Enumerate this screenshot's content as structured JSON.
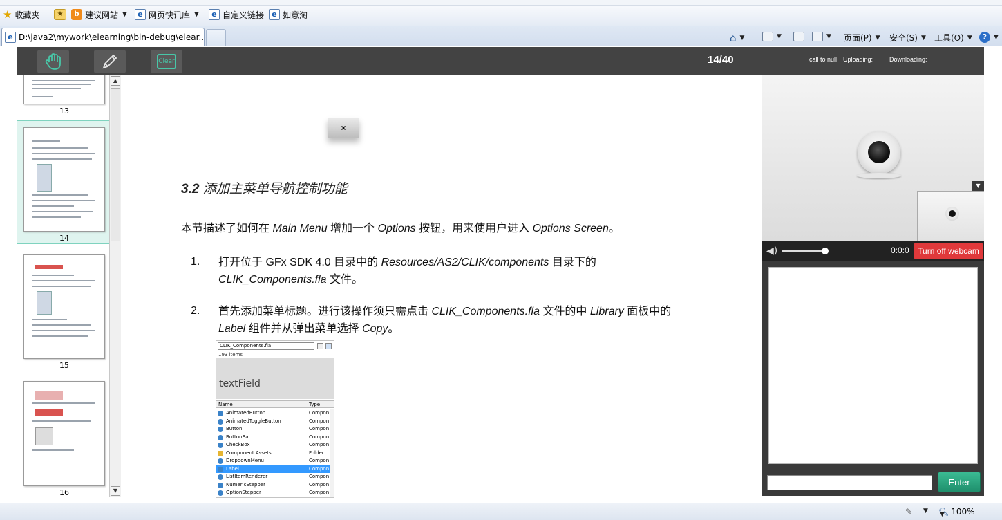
{
  "favorites_bar": {
    "favorites_label": "收藏夹",
    "items": [
      {
        "label": "建议网站",
        "icon": "suggested-sites-icon"
      },
      {
        "label": "网页快讯库",
        "icon": "web-slice-icon"
      },
      {
        "label": "自定义链接",
        "icon": "ie-page-icon"
      },
      {
        "label": "如意淘",
        "icon": "ie-page-icon"
      }
    ]
  },
  "tabs": {
    "active_title": "D:\\java2\\mywork\\elearning\\bin-debug\\elear..."
  },
  "command_bar": {
    "page_label": "页面(P)",
    "safety_label": "安全(S)",
    "tools_label": "工具(O)",
    "help_label": "?"
  },
  "toolbar": {
    "hand_tool": "hand-icon",
    "pen_tool": "pencil-icon",
    "clear_label": "Clear",
    "page_counter": "14/40",
    "status_call": "call to null",
    "status_upload": "Uploading:",
    "status_download": "Downloading:"
  },
  "thumbnails": [
    {
      "label": "13"
    },
    {
      "label": "14",
      "selected": true
    },
    {
      "label": "15"
    },
    {
      "label": "16"
    }
  ],
  "document": {
    "close_label": "×",
    "section_number": "3.2",
    "section_title": "添加主菜单导航控制功能",
    "intro": {
      "a": "本节描述了如何在 ",
      "b": "Main Menu",
      "c": " 增加一个 ",
      "d": "Options",
      "e": " 按钮，用来使用户进入 ",
      "f": "Options Screen",
      "g": "。"
    },
    "steps": [
      {
        "num": "1.",
        "a": "打开位于 GFx SDK 4.0 目录中的 ",
        "b": "Resources/AS2/CLIK/components",
        "c": " 目录下的",
        "d": "CLIK_Components.fla",
        "e": " 文件。"
      },
      {
        "num": "2.",
        "a": "首先添加菜单标题。进行该操作须只需点击 ",
        "b": "CLIK_Components.fla",
        "c": " 文件的中 ",
        "d": "Library",
        "e": " 面板中的",
        "f": "Label",
        "g": " 组件并从弹出菜单选择 ",
        "h": "Copy",
        "i": "。"
      }
    ],
    "library_panel": {
      "file": "CLIK_Components.fla",
      "count": "193 items",
      "preview": "textField",
      "col_name": "Name",
      "col_type": "Type",
      "rows": [
        {
          "name": "AnimatedButton",
          "type": "Compon"
        },
        {
          "name": "AnimatedToggleButton",
          "type": "Compon"
        },
        {
          "name": "Button",
          "type": "Compon"
        },
        {
          "name": "ButtonBar",
          "type": "Compon"
        },
        {
          "name": "CheckBox",
          "type": "Compon"
        },
        {
          "name": "Component Assets",
          "type": "Folder"
        },
        {
          "name": "DropdownMenu",
          "type": "Compon"
        },
        {
          "name": "Label",
          "type": "Compon",
          "selected": true
        },
        {
          "name": "ListItemRenderer",
          "type": "Compon"
        },
        {
          "name": "NumericStepper",
          "type": "Compon"
        },
        {
          "name": "OptionStepper",
          "type": "Compon"
        }
      ]
    }
  },
  "webcam": {
    "time": "0:0:0",
    "toggle_label": "Turn off webcam"
  },
  "chat": {
    "input_value": "",
    "enter_label": "Enter"
  },
  "status_bar": {
    "zoom": "100%"
  }
}
